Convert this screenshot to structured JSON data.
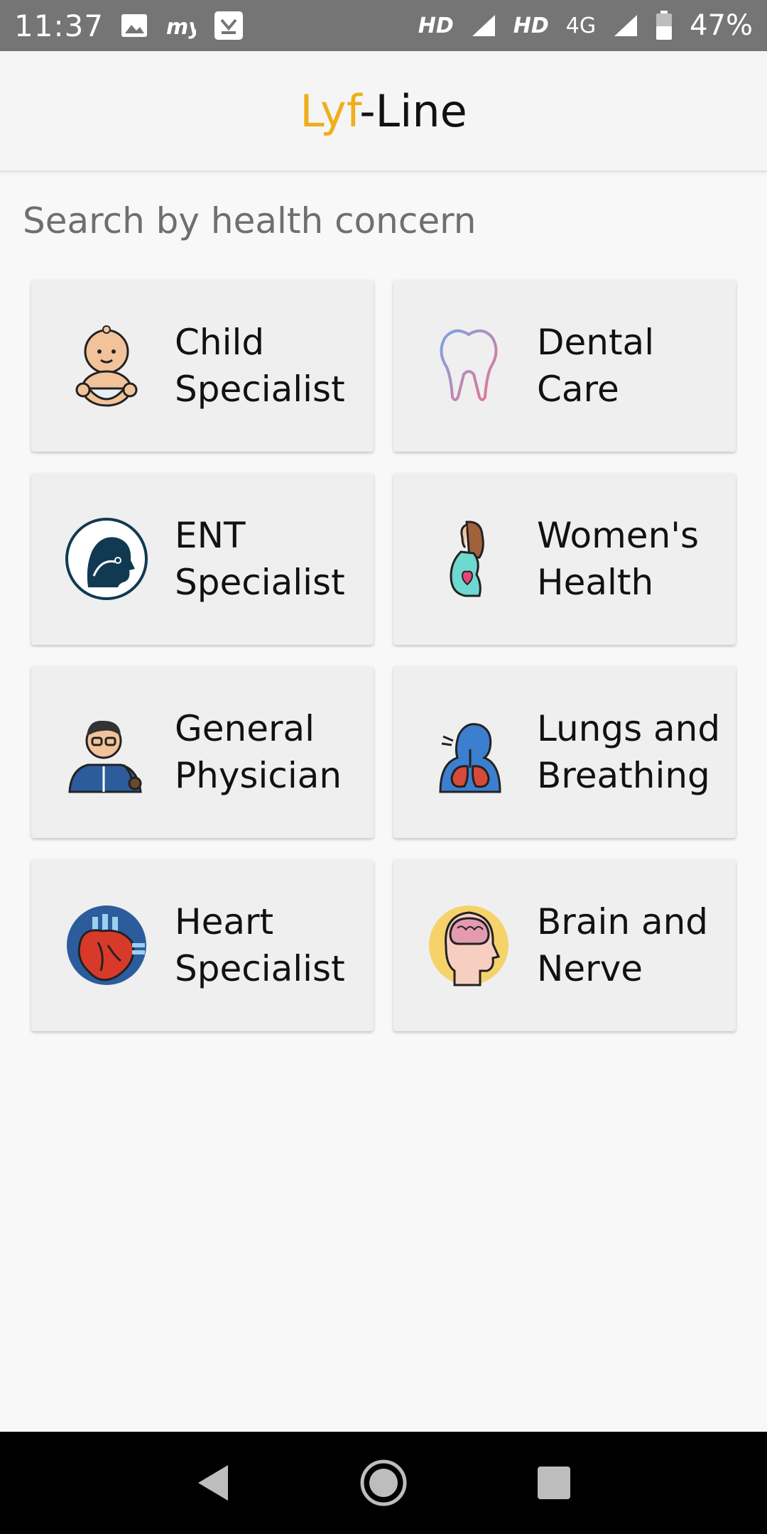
{
  "status_bar": {
    "time": "11:37",
    "network_1": "HD",
    "network_2": "HD",
    "network_3": "4G",
    "battery": "47%"
  },
  "app": {
    "brand_part1": "Lyf",
    "brand_part2": "-Line",
    "accent_color": "#f0ae1c"
  },
  "section": {
    "title": "Search by health concern"
  },
  "categories": [
    {
      "label": "Child\nSpecialist",
      "icon": "baby-icon"
    },
    {
      "label": "Dental\nCare",
      "icon": "tooth-icon"
    },
    {
      "label": "ENT\nSpecialist",
      "icon": "ent-head-icon"
    },
    {
      "label": "Women's\nHealth",
      "icon": "pregnant-woman-icon"
    },
    {
      "label": "General\nPhysician",
      "icon": "doctor-icon"
    },
    {
      "label": "Lungs and\nBreathing",
      "icon": "lungs-icon"
    },
    {
      "label": "Heart\nSpecialist",
      "icon": "heart-icon"
    },
    {
      "label": "Brain and\nNerve",
      "icon": "brain-icon"
    }
  ],
  "nav": {
    "back": "back-icon",
    "home": "home-icon",
    "recents": "recents-icon"
  }
}
